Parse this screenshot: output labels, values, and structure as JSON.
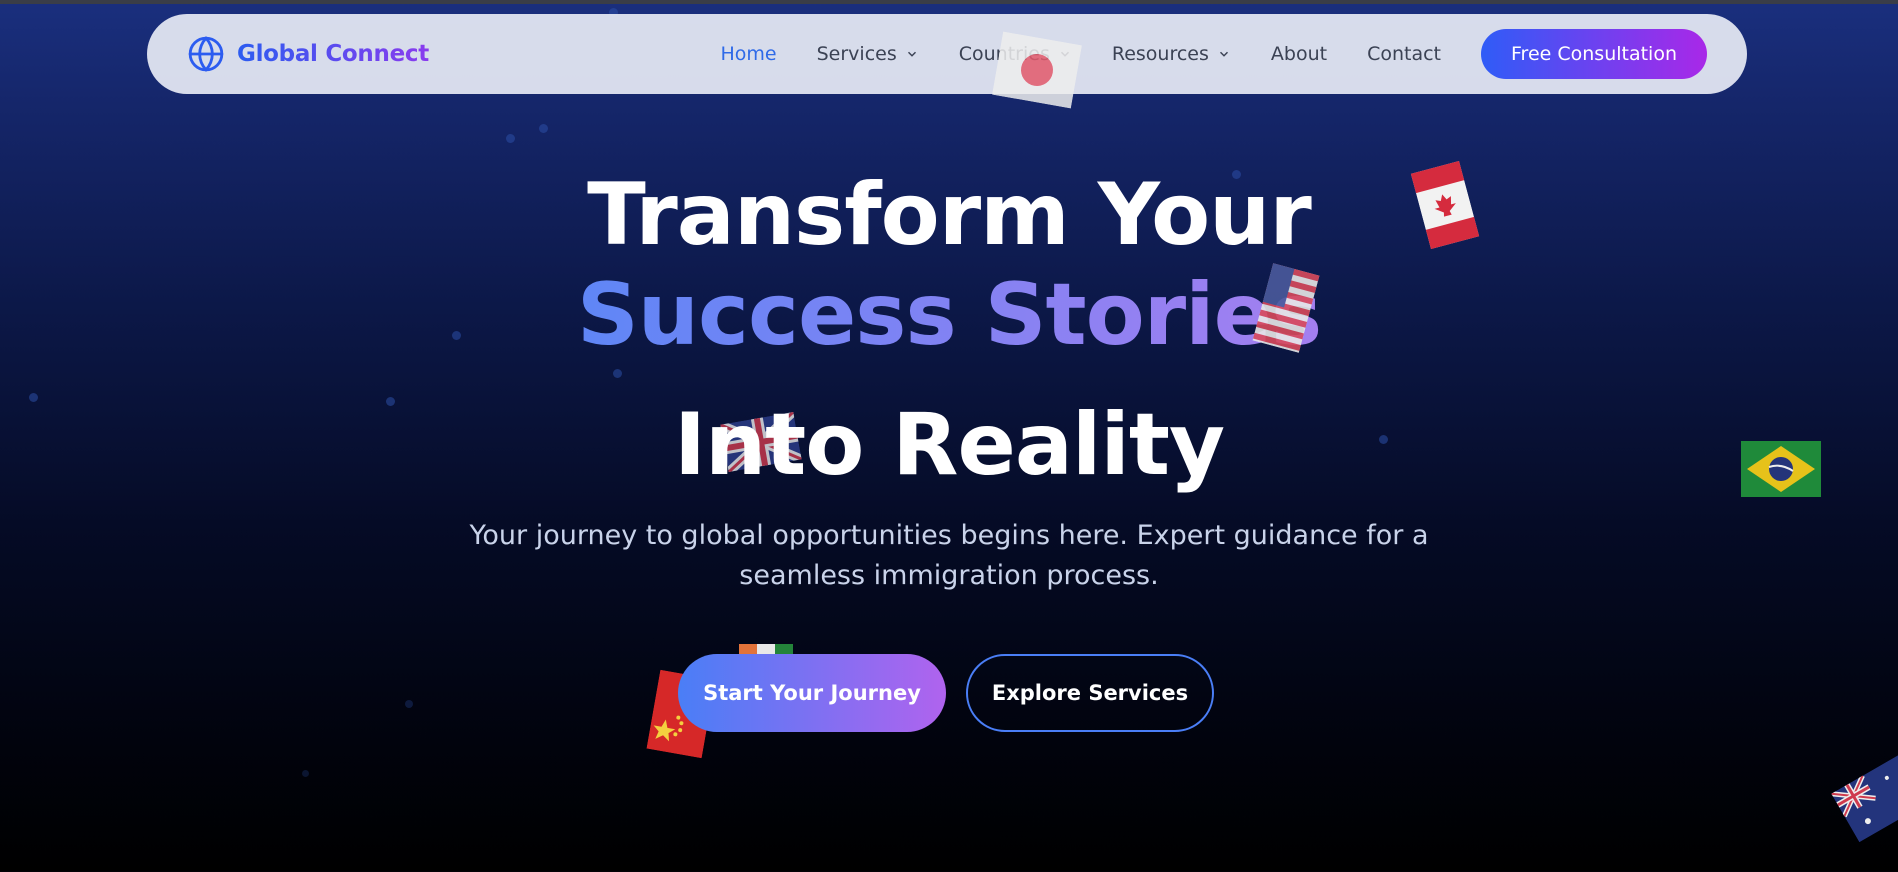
{
  "brand": {
    "name": "Global Connect",
    "icon": "globe-icon",
    "color_start": "#2c5cf0",
    "color_end": "#8a3bee"
  },
  "nav": {
    "items": [
      {
        "label": "Home",
        "active": true,
        "dropdown": false
      },
      {
        "label": "Services",
        "active": false,
        "dropdown": true
      },
      {
        "label": "Countries",
        "active": false,
        "dropdown": true
      },
      {
        "label": "Resources",
        "active": false,
        "dropdown": true
      },
      {
        "label": "About",
        "active": false,
        "dropdown": false
      },
      {
        "label": "Contact",
        "active": false,
        "dropdown": false
      }
    ],
    "cta_label": "Free Consultation"
  },
  "hero": {
    "line1": "Transform Your",
    "line2": "Success Stories",
    "line3": "Into Reality",
    "subtitle_line1": "Your journey to global opportunities begins here. Expert guidance for a",
    "subtitle_line2": "seamless immigration process.",
    "primary_button": "Start Your Journey",
    "secondary_button": "Explore Services"
  },
  "decorations": {
    "flags": [
      "japan-flag",
      "canada-flag",
      "usa-flag",
      "uk-flag",
      "brazil-flag",
      "india-flag",
      "china-flag",
      "australia-flag"
    ]
  },
  "colors": {
    "accent_blue": "#2f6ae8",
    "cta_gradient_start": "#2f5cf7",
    "cta_gradient_end": "#a928e8"
  }
}
